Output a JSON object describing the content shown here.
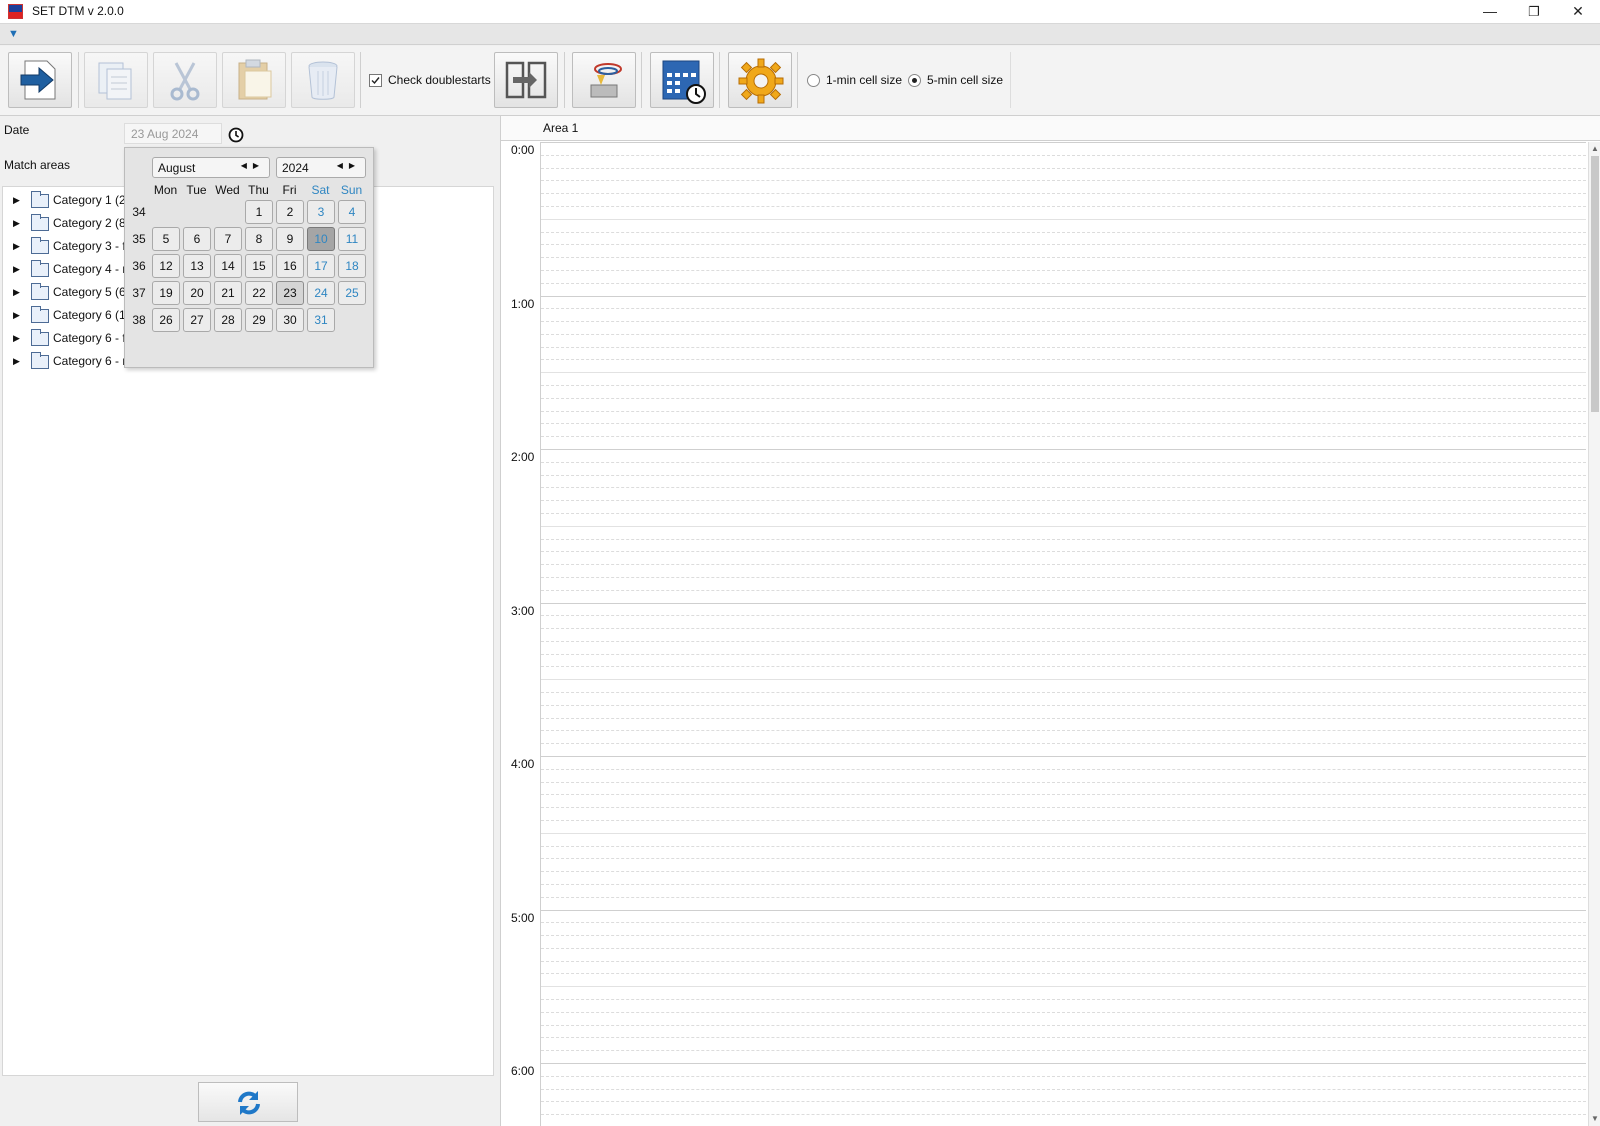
{
  "window": {
    "title": "SET DTM v 2.0.0",
    "minimize": "—",
    "maximize": "❐",
    "close": "✕"
  },
  "menu": {
    "arrow": "▼"
  },
  "toolbar": {
    "check_doublestarts": {
      "label": "Check doublestarts",
      "checked": true
    },
    "cell_size": {
      "option1": "1-min cell size",
      "option2": "5-min cell size",
      "selected": "5-min cell size"
    }
  },
  "left": {
    "date_label": "Date",
    "date_value": "23 Aug 2024",
    "match_areas_label": "Match areas",
    "tree_items": [
      "Category 1 (21",
      "Category 2 (8)",
      "Category 3 - fe",
      "Category 4 - m",
      "Category 5 (6)",
      "Category 6 (18",
      "Category 6 - fe",
      "Category 6 - m"
    ]
  },
  "calendar": {
    "month": "August",
    "year": "2024",
    "day_headers": [
      "Mon",
      "Tue",
      "Wed",
      "Thu",
      "Fri",
      "Sat",
      "Sun"
    ],
    "weeks": [
      {
        "num": "34",
        "days": [
          "",
          "",
          "",
          "1",
          "2",
          "3",
          "4"
        ]
      },
      {
        "num": "35",
        "days": [
          "5",
          "6",
          "7",
          "8",
          "9",
          "10",
          "11"
        ]
      },
      {
        "num": "36",
        "days": [
          "12",
          "13",
          "14",
          "15",
          "16",
          "17",
          "18"
        ]
      },
      {
        "num": "37",
        "days": [
          "19",
          "20",
          "21",
          "22",
          "23",
          "24",
          "25"
        ]
      },
      {
        "num": "38",
        "days": [
          "26",
          "27",
          "28",
          "29",
          "30",
          "31",
          ""
        ]
      }
    ],
    "selected_day": "10",
    "today_day": "23"
  },
  "schedule": {
    "area": "Area 1",
    "hours": [
      "0:00",
      "1:00",
      "2:00",
      "3:00",
      "4:00",
      "5:00",
      "6:00"
    ]
  }
}
